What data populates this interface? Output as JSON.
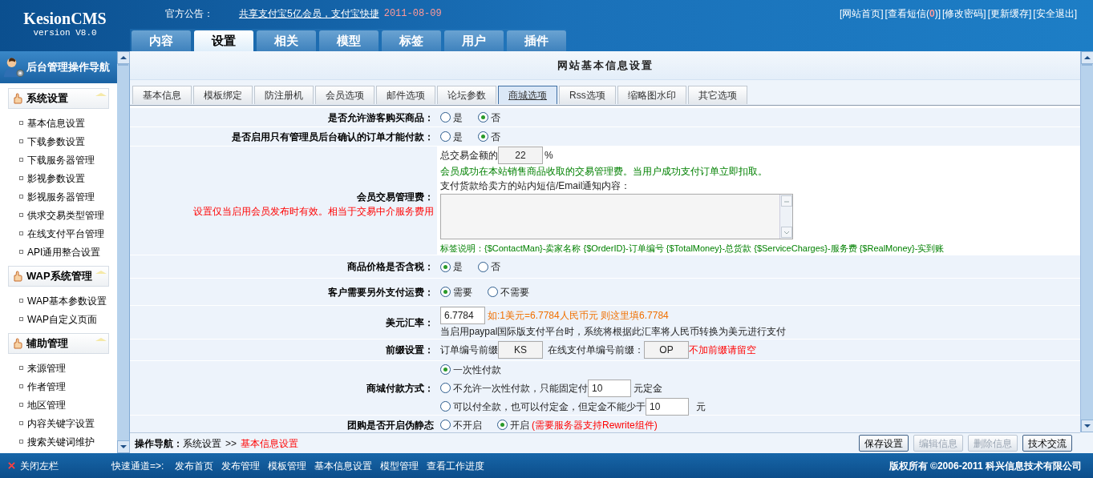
{
  "header": {
    "logo": "KesionCMS",
    "version": "version V8.0",
    "notice_label": "官方公告：",
    "notice_link": "共享支付宝5亿会员，支付宝快捷",
    "notice_date": "2011-08-09",
    "top_links": [
      {
        "label": "[网站首页]"
      },
      {
        "label": "[查看短信(",
        "count": "0",
        "suffix": ")]"
      },
      {
        "label": "[修改密码]"
      },
      {
        "label": "[更新缓存]"
      },
      {
        "label": "[安全退出]"
      }
    ]
  },
  "main_tabs": [
    {
      "label": "内容",
      "selected": false
    },
    {
      "label": "设置",
      "selected": true
    },
    {
      "label": "相关",
      "selected": false
    },
    {
      "label": "模型",
      "selected": false
    },
    {
      "label": "标签",
      "selected": false
    },
    {
      "label": "用户",
      "selected": false
    },
    {
      "label": "插件",
      "selected": false
    }
  ],
  "sidebar": {
    "title": "后台管理操作导航",
    "sections": [
      {
        "title": "系统设置",
        "items": [
          "基本信息设置",
          "下载参数设置",
          "下载服务器管理",
          "影视参数设置",
          "影视服务器管理",
          "供求交易类型管理",
          "在线支付平台管理",
          "API通用整合设置"
        ]
      },
      {
        "title": "WAP系统管理",
        "items": [
          "WAP基本参数设置",
          "WAP自定义页面"
        ]
      },
      {
        "title": "辅助管理",
        "items": [
          "来源管理",
          "作者管理",
          "地区管理",
          "内容关键字设置",
          "搜索关键词维护"
        ]
      }
    ]
  },
  "panel": {
    "title": "网站基本信息设置",
    "sub_tabs": [
      {
        "label": "基本信息",
        "selected": false
      },
      {
        "label": "模板绑定",
        "selected": false
      },
      {
        "label": "防注册机",
        "selected": false
      },
      {
        "label": "会员选项",
        "selected": false
      },
      {
        "label": "邮件选项",
        "selected": false
      },
      {
        "label": "论坛参数",
        "selected": false
      },
      {
        "label": "商城选项",
        "selected": true
      },
      {
        "label": "Rss选项",
        "selected": false
      },
      {
        "label": "缩略图水印",
        "selected": false
      },
      {
        "label": "其它选项",
        "selected": false
      }
    ],
    "rows": [
      {
        "kind": "radio",
        "label": "是否允许游客购买商品：",
        "options": [
          {
            "label": "是",
            "selected": false
          },
          {
            "label": "否",
            "selected": true
          }
        ]
      },
      {
        "kind": "radio",
        "label": "是否启用只有管理员后台确认的订单才能付款：",
        "options": [
          {
            "label": "是",
            "selected": false
          },
          {
            "label": "否",
            "selected": true
          }
        ]
      },
      {
        "kind": "fee",
        "label": "会员交易管理费：",
        "note": "设置仅当启用会员发布时有效。相当于交易中介服务费用",
        "prefix": "总交易金额的",
        "value": "22",
        "unit": "%",
        "help": "会员成功在本站销售商品收取的交易管理费。当用户成功支付订单立即扣取。",
        "message_label": "支付货款给卖方的站内短信/Email通知内容：",
        "tags": "标签说明：{$ContactMan}-卖家名称 {$OrderID}-订单编号 {$TotalMoney}-总货款 {$ServiceCharges}-服务费 {$RealMoney}-实到账"
      },
      {
        "kind": "radio",
        "label": "商品价格是否含税：",
        "options": [
          {
            "label": "是",
            "selected": true
          },
          {
            "label": "否",
            "selected": false
          }
        ]
      },
      {
        "kind": "radio",
        "label": "客户需要另外支付运费：",
        "options": [
          {
            "label": "需要",
            "selected": true
          },
          {
            "label": "不需要",
            "selected": false
          }
        ]
      },
      {
        "kind": "rate",
        "label": "美元汇率：",
        "value": "6.7784",
        "hint": "如:1美元=6.7784人民币元 则这里填6.7784",
        "help": "当启用paypal国际版支付平台时，系统将根据此汇率将人民币转换为美元进行支付"
      },
      {
        "kind": "prefix",
        "label": "前缀设置：",
        "fields": [
          {
            "label": "订单编号前缀",
            "value": "KS"
          },
          {
            "label": "在线支付单编号前缀：",
            "value": "OP"
          }
        ],
        "hint": "不加前缀请留空"
      },
      {
        "kind": "payment",
        "label": "商城付款方式：",
        "options": [
          {
            "before": "一次性付款",
            "selected": true
          },
          {
            "before": "不允许一次性付款，只能固定付",
            "value": "10",
            "after": "元定金",
            "selected": false
          },
          {
            "before": "可以付全款，也可以付定金，但定金不能少于",
            "value": "10",
            "after": "元",
            "selected": false
          }
        ]
      },
      {
        "kind": "radio",
        "label": "团购是否开启伪静态",
        "options": [
          {
            "label": "不开启",
            "selected": false
          },
          {
            "label": "开启",
            "selected": true
          }
        ],
        "note": "(需要服务器支持Rewrite组件)"
      }
    ]
  },
  "bottom_bar": {
    "nav_label": "操作导航：",
    "path": "系统设置",
    "separator": ">>",
    "current": "基本信息设置",
    "buttons": [
      {
        "label": "保存设置",
        "disabled": false
      },
      {
        "label": "编辑信息",
        "disabled": true
      },
      {
        "label": "删除信息",
        "disabled": true
      },
      {
        "label": "技术交流",
        "disabled": false
      }
    ]
  },
  "footer": {
    "close_label": "关闭左栏",
    "quick_label": "快速通道=>:",
    "quick_links": [
      "发布首页",
      "发布管理",
      "模板管理",
      "基本信息设置",
      "模型管理",
      "查看工作进度"
    ],
    "copyright": "版权所有 ©2006-2011 科兴信息技术有限公司"
  }
}
